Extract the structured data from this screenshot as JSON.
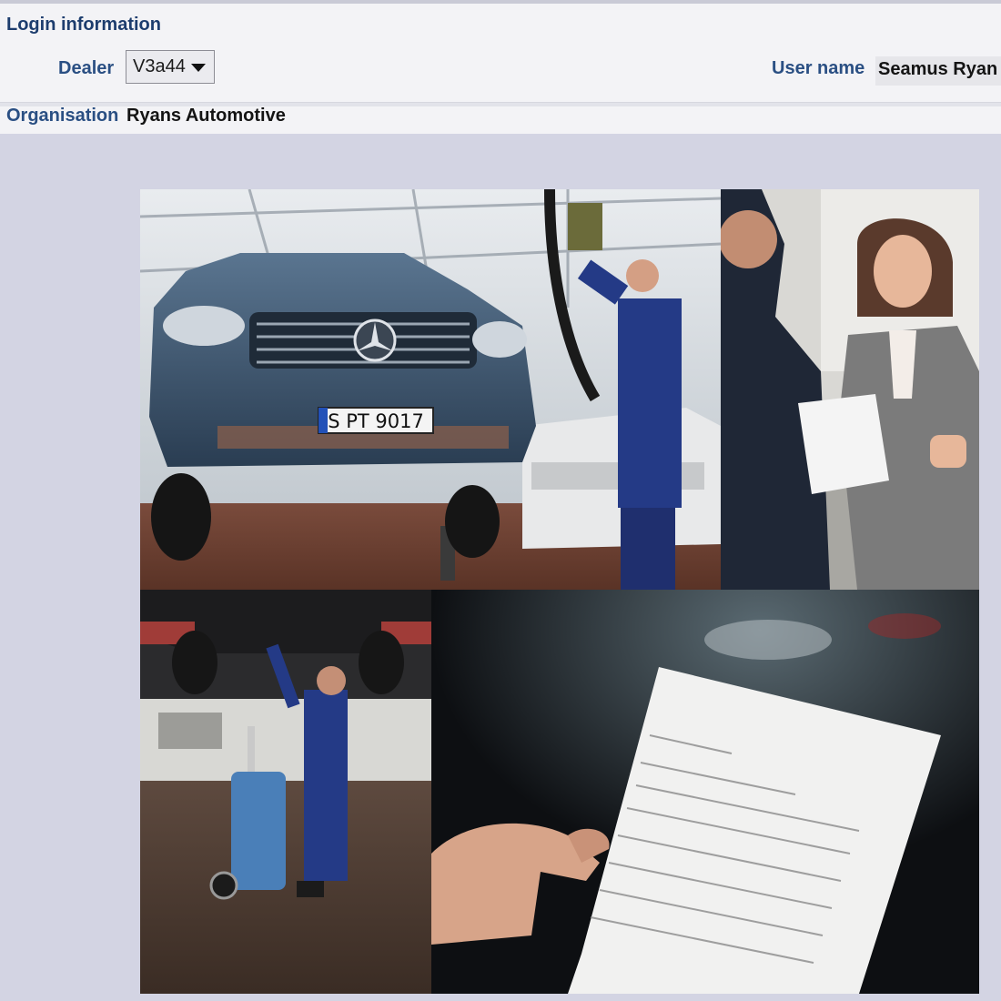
{
  "login": {
    "title": "Login information",
    "dealer_label": "Dealer",
    "dealer_value": "V3a44",
    "user_label": "User name",
    "user_value": "Seamus Ryan",
    "org_label": "Organisation",
    "org_value": "Ryans Automotive"
  },
  "collage": {
    "photo1": {
      "plate": "S PT 9017"
    }
  },
  "colors": {
    "label_blue": "#2a4f83",
    "page_bg": "#d3d4e3",
    "panel_bg": "#f3f3f6"
  }
}
